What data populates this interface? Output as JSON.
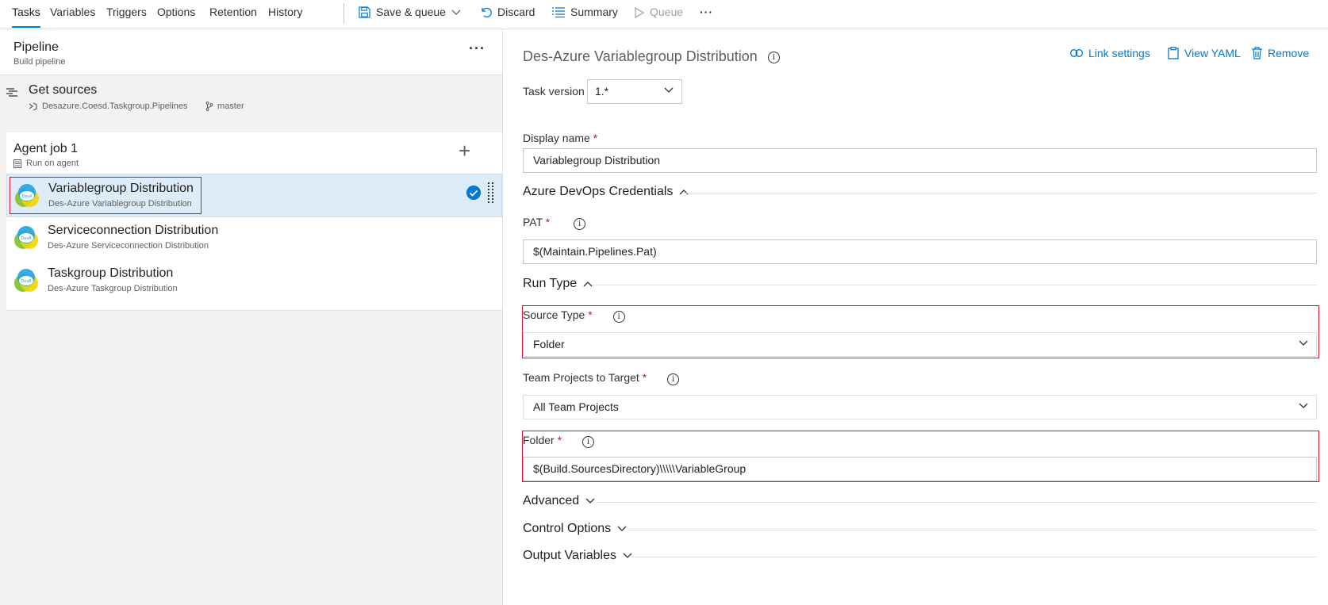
{
  "toolbar": {
    "tabs": [
      "Tasks",
      "Variables",
      "Triggers",
      "Options",
      "Retention",
      "History"
    ],
    "active_tab": "Tasks",
    "save_queue": "Save & queue",
    "discard": "Discard",
    "summary": "Summary",
    "queue": "Queue",
    "more": "···"
  },
  "pipeline": {
    "title": "Pipeline",
    "subtitle": "Build pipeline",
    "more": "···"
  },
  "sources": {
    "title": "Get sources",
    "repo": "Desazure.Coesd.Taskgroup.Pipelines",
    "branch": "master"
  },
  "job": {
    "title": "Agent job 1",
    "subtitle": "Run on agent",
    "add": "+"
  },
  "tasks": [
    {
      "title": "Variablegroup Distribution",
      "subtitle": "Des-Azure Variablegroup Distribution"
    },
    {
      "title": "Serviceconnection Distribution",
      "subtitle": "Des-Azure Serviceconnection Distribution"
    },
    {
      "title": "Taskgroup Distribution",
      "subtitle": "Des-Azure Taskgroup Distribution"
    }
  ],
  "detail": {
    "title": "Des-Azure Variablegroup Distribution",
    "link_settings": "Link settings",
    "view_yaml": "View YAML",
    "remove": "Remove",
    "task_version_label": "Task version",
    "task_version": "1.*",
    "display_name_label": "Display name",
    "display_name": "Variablegroup Distribution",
    "credentials_section": "Azure DevOps Credentials",
    "pat_label": "PAT",
    "pat_value": "$(Maintain.Pipelines.Pat)",
    "run_type_section": "Run Type",
    "source_type_label": "Source Type",
    "source_type_value": "Folder",
    "team_projects_label": "Team Projects to Target",
    "team_projects_value": "All Team Projects",
    "folder_label": "Folder",
    "folder_value": "$(Build.SourcesDirectory)\\\\\\\\\\VariableGroup",
    "advanced_section": "Advanced",
    "control_options_section": "Control Options",
    "output_variables_section": "Output Variables",
    "required_mark": "*",
    "info_glyph": "i"
  },
  "colors": {
    "accent": "#0078d4",
    "highlight": "#e81123",
    "selected_bg": "#deecf9"
  }
}
